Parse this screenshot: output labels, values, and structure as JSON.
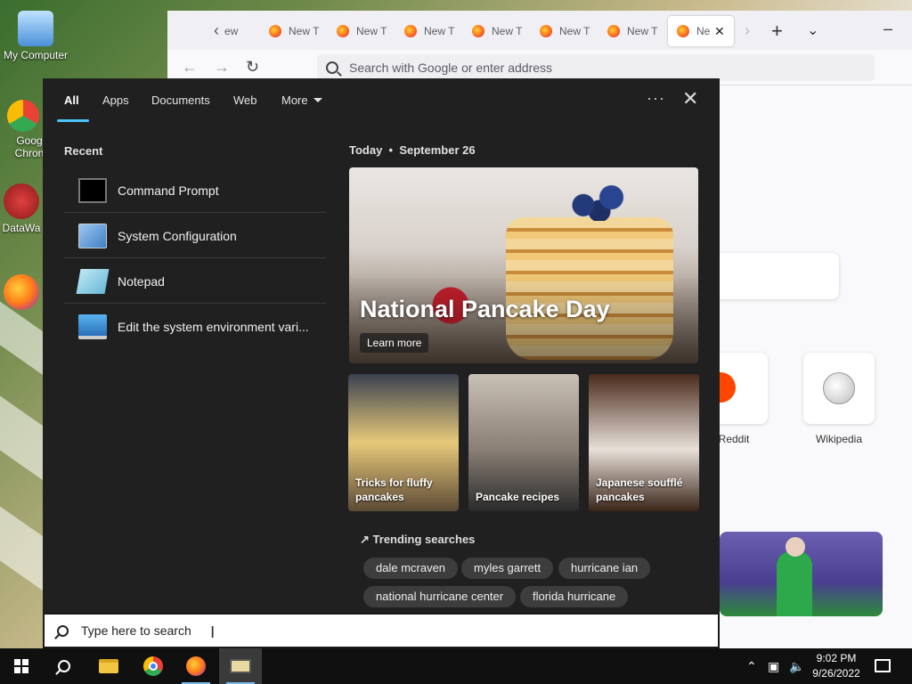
{
  "desktop": {
    "icons": [
      {
        "label": "My Computer"
      },
      {
        "label": "Goog Chron"
      },
      {
        "label": "DataWa"
      }
    ]
  },
  "browser": {
    "tabs": [
      {
        "label": "ew"
      },
      {
        "label": "New T"
      },
      {
        "label": "New T"
      },
      {
        "label": "New T"
      },
      {
        "label": "New T"
      },
      {
        "label": "New T"
      },
      {
        "label": "New T"
      },
      {
        "label": "Ne"
      }
    ],
    "address_placeholder": "Search with Google or enter address",
    "shortcuts": [
      {
        "label": "Reddit"
      },
      {
        "label": "Wikipedia"
      }
    ]
  },
  "search_panel": {
    "tabs": [
      {
        "label": "All"
      },
      {
        "label": "Apps"
      },
      {
        "label": "Documents"
      },
      {
        "label": "Web"
      },
      {
        "label": "More"
      }
    ],
    "recent_title": "Recent",
    "recent": [
      {
        "label": "Command Prompt"
      },
      {
        "label": "System Configuration"
      },
      {
        "label": "Notepad"
      },
      {
        "label": "Edit the system environment vari..."
      }
    ],
    "today_label": "Today",
    "today_date": "September 26",
    "hero": {
      "title": "National Pancake Day",
      "button": "Learn more"
    },
    "cards": [
      {
        "caption": "Tricks for fluffy pancakes"
      },
      {
        "caption": "Pancake recipes"
      },
      {
        "caption": "Japanese soufflé pancakes"
      }
    ],
    "trending_title": "Trending searches",
    "trending": [
      "dale mcraven",
      "myles garrett",
      "hurricane ian",
      "national hurricane center",
      "florida hurricane"
    ]
  },
  "search_box": {
    "placeholder": "Type here to search"
  },
  "taskbar": {
    "time": "9:02 PM",
    "date": "9/26/2022"
  },
  "colors": {
    "panel_bg": "#202020",
    "accent": "#4cc2ff",
    "taskbar_bg": "#101010"
  }
}
